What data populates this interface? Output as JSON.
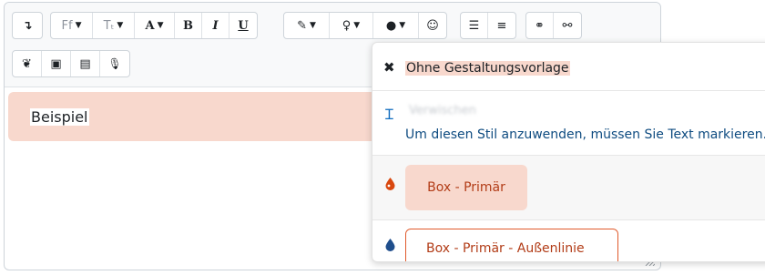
{
  "toolbar": {
    "row1": [
      {
        "name": "undo-arrow-button",
        "glyph": "↴"
      },
      {
        "name": "font-family-button",
        "glyph": "Ff",
        "caret": true
      },
      {
        "name": "font-size-button",
        "glyph": "Tₜ",
        "caret": true
      },
      {
        "name": "text-color-button",
        "glyph": "A",
        "caret": true
      },
      {
        "name": "bold-button",
        "glyph": "B"
      },
      {
        "name": "italic-button",
        "glyph": "I"
      },
      {
        "name": "underline-button",
        "glyph": "U"
      },
      {
        "name": "brush-button",
        "glyph": "✎",
        "caret": true
      },
      {
        "name": "bulb-button",
        "glyph": "♀",
        "caret": true
      },
      {
        "name": "drop-button",
        "glyph": "●",
        "caret": true
      },
      {
        "name": "emoji-button",
        "glyph": "☺"
      },
      {
        "name": "bullet-list-button",
        "glyph": "☰"
      },
      {
        "name": "numbered-list-button",
        "glyph": "≡"
      },
      {
        "name": "link-button",
        "glyph": "⚭"
      },
      {
        "name": "unlink-button",
        "glyph": "⚯"
      }
    ],
    "row2": [
      {
        "name": "leaf-button",
        "glyph": "❦"
      },
      {
        "name": "image-button",
        "glyph": "▣"
      },
      {
        "name": "media-button",
        "glyph": "▤"
      },
      {
        "name": "microphone-button",
        "glyph": "🎙"
      }
    ]
  },
  "editor": {
    "paragraph_text": "Beispiel"
  },
  "menu": {
    "item_none_label": "Ohne Gestaltungsvorlage",
    "item_blurred_label": "Verwischen",
    "hint_text": "Um diesen Stil anzuwenden, müssen Sie Text markieren.",
    "box_primary_label": "Box - Primär",
    "box_outline_label": "Box - Primär - Außenlinie"
  },
  "colors": {
    "accent_pink": "#f8d8cd",
    "drop_orange": "#d9480f",
    "drop_blue": "#1f4e8c",
    "hint_blue": "#0f4c81"
  }
}
